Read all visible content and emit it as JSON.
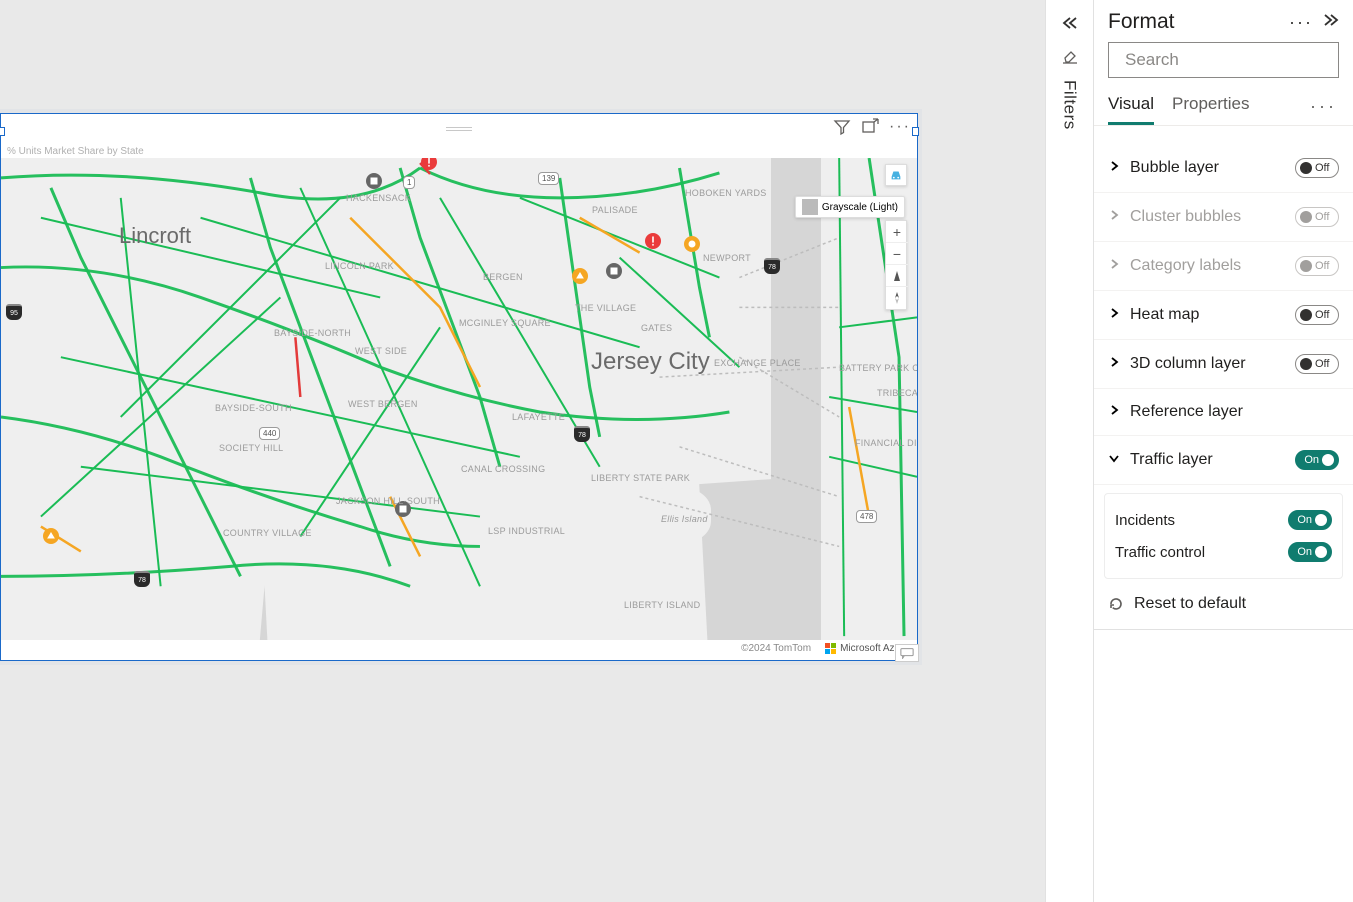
{
  "visual": {
    "title": "% Units Market Share by State"
  },
  "map": {
    "style_chip": "Grayscale (Light)",
    "attribution": "©2024 TomTom",
    "provider": "Microsoft Azure",
    "labels": {
      "city": "Jersey City",
      "lincroft": "Lincroft",
      "hackensack": "HACKENSACK",
      "palisade": "PALISADE",
      "hoboken": "HOBOKEN YARDS",
      "newport": "NEWPORT",
      "bergen": "BERGEN",
      "lincoln_park": "LINCOLN PARK",
      "bayside_north": "BAYSIDE-NORTH",
      "bayside_south": "BAYSIDE-SOUTH",
      "west_side": "WEST SIDE",
      "west_bergen": "WEST BERGEN",
      "mcginley": "MCGINLEY SQUARE",
      "lafayette": "LAFAYETTE",
      "the_village": "THE VILLAGE",
      "exchange_place": "EXCHANGE PLACE",
      "battery": "BATTERY PARK CITY",
      "liberty_park": "LIBERTY STATE PARK",
      "canal_crossing": "CANAL CROSSING",
      "lsp": "LSP INDUSTRIAL",
      "ellis": "Ellis Island",
      "liberty_island": "LIBERTY ISLAND",
      "jackson": "JACKSON HILL-SOUTH",
      "country": "COUNTRY VILLAGE",
      "society": "SOCIETY HILL",
      "tribeca": "TRIBECA",
      "financial": "FINANCIAL DISTRICT",
      "gates": "GATES"
    },
    "shields": {
      "r1": "1",
      "r139": "139",
      "r440": "440",
      "r478": "478",
      "i78a": "78",
      "i78b": "78",
      "i78c": "78",
      "i95": "95"
    }
  },
  "filters_rail": {
    "label": "Filters"
  },
  "format": {
    "title": "Format",
    "search_placeholder": "Search",
    "tabs": {
      "visual": "Visual",
      "properties": "Properties"
    },
    "toggle_labels": {
      "on": "On",
      "off": "Off"
    },
    "rows": {
      "bubble": "Bubble layer",
      "cluster": "Cluster bubbles",
      "category": "Category labels",
      "heat": "Heat map",
      "col3d": "3D column layer",
      "reference": "Reference layer",
      "traffic": "Traffic layer"
    },
    "sub": {
      "incidents": "Incidents",
      "traffic_control": "Traffic control"
    },
    "reset": "Reset to default"
  }
}
